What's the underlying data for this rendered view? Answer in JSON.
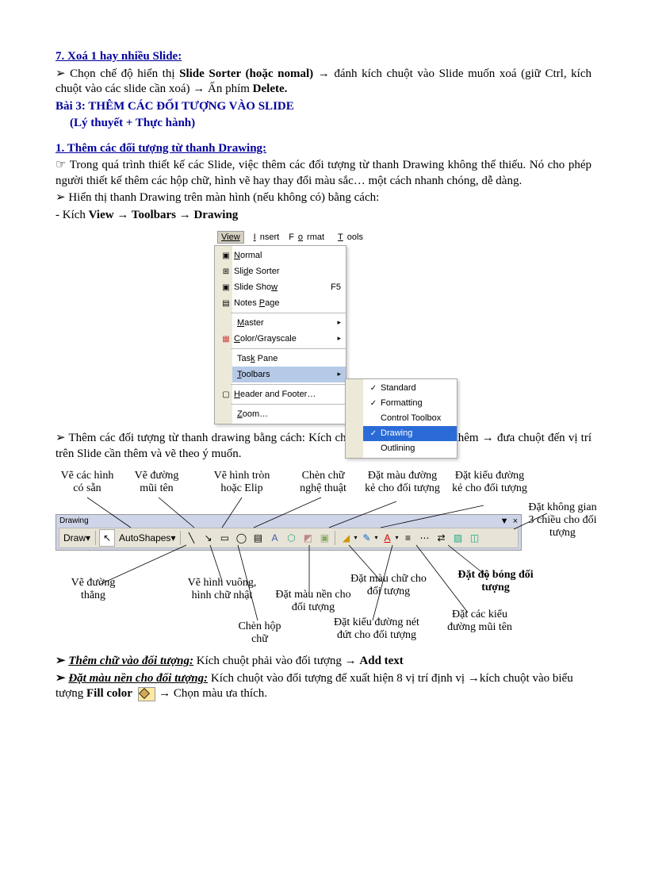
{
  "sec7_title": "7.  Xoá 1 hay nhiều Slide:",
  "sec7_l1a": "➢ Chọn chế độ hiển thị ",
  "sec7_l1b": "Slide Sorter (hoặc nomal) ",
  "sec7_l1c": "→",
  "sec7_l1d": " đánh kích chuột vào  Slide muốn xoá (giữ Ctrl, kích chuột vào các slide cần xoá) → Ấn phím ",
  "sec7_l1e": "Delete.",
  "bai3": "Bài 3: THÊM CÁC ĐỐI TƯỢNG VÀO SLIDE",
  "bai3_sub": "(Lý thuyết + Thực hành)",
  "sec1_title": "1.  Thêm các đối tượng từ thanh Drawing:",
  "sec1_p1": "☞ Trong quá trình thiết kế các Slide, việc thêm các đối tượng từ thanh Drawing không thể thiếu. Nó cho phép người thiết kế thêm các hộp chữ, hình vẽ hay thay đổi màu sắc… một cách nhanh chóng, dễ dàng.",
  "sec1_p2": "➢ Hiển thị thanh Drawing trên màn hình (nếu không có) bằng cách:",
  "sec1_p3a": "- Kích ",
  "sec1_p3b": "View → Toolbars → Drawing",
  "menubar": {
    "view": "View",
    "insert": "Insert",
    "format": "Format",
    "tools": "Tools"
  },
  "menu": {
    "normal": "Normal",
    "sorter": "Slide Sorter",
    "show": "Slide Show",
    "show_sc": "F5",
    "notes": "Notes Page",
    "master": "Master",
    "color": "Color/Grayscale",
    "taskpane": "Task Pane",
    "toolbars": "Toolbars",
    "header": "Header and Footer…",
    "zoom": "Zoom…"
  },
  "submenu": {
    "standard": "Standard",
    "formatting": "Formatting",
    "control": "Control Toolbox",
    "drawing": "Drawing",
    "outlining": "Outlining"
  },
  "after1": "➢ Thêm các đối tượng từ thanh drawing bằng cách: Kích chuột vào đối tượng cần thêm → đưa chuột đến vị trí trên Slide cần thêm và vẽ theo ý muốn.",
  "tb": {
    "title": "Drawing",
    "draw": "Draw",
    "autoshapes": "AutoShapes",
    "close": "▼ ×"
  },
  "cl": {
    "c1": "Vẽ các hình có sẵn",
    "c2": "Vẽ đường mũi tên",
    "c3": "Vẽ hình tròn hoặc Elip",
    "c4": "Chèn chữ nghệ thuật",
    "c5": "Đặt màu đường kẻ cho đối tượng",
    "c6": "Đặt kiểu đường kẻ cho đối tượng",
    "c7": "Đặt không gian 3 chiều cho đối tượng",
    "c8": "Vẽ đường thẳng",
    "c9": "Vẽ hình vuông, hình chữ nhật",
    "c10": "Chèn hộp chữ",
    "c11": "Đặt màu nền cho đối tượng",
    "c12": "Đặt màu chữ cho đối tượng",
    "c13": "Đặt kiểu đường nét đứt cho đối tượng",
    "c14": "Đặt các kiểu đường mũi tên",
    "c15": "Đặt độ bóng đối tượng"
  },
  "f1a": "➢ ",
  "f1b": "Thêm chữ vào đối tượng:",
  "f1c": " Kích chuột phải vào đối tượng → ",
  "f1d": "Add text",
  "f2a": "➢ ",
  "f2b": "Đặt màu nền cho đối tượng:",
  "f2c": " Kích chuột vào đối tượng  để xuất hiện 8 vị trí định vị →kích chuột vào biểu tượng ",
  "f2d": "Fill color",
  "f2e": " → Chọn màu ưa thích."
}
